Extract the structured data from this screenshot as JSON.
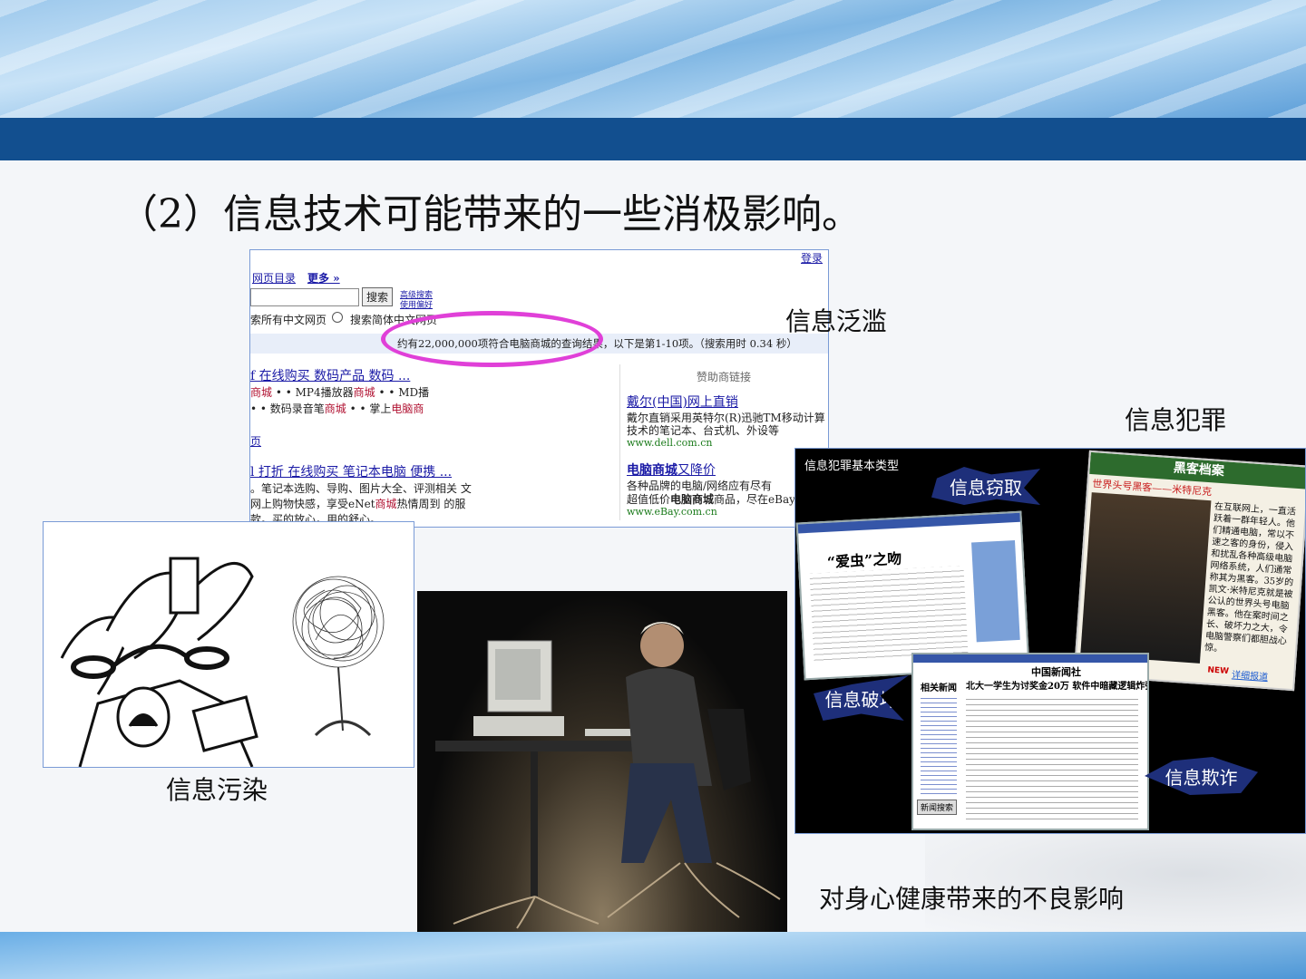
{
  "slide": {
    "heading": "（2）信息技术可能带来的一些消极影响。"
  },
  "captions": {
    "overload": "信息泛滥",
    "crime": "信息犯罪",
    "pollution": "信息污染",
    "health": "对身心健康带来的不良影响"
  },
  "search_screenshot": {
    "login": "登录",
    "nav_directory": "网页目录",
    "nav_more": "更多 »",
    "search_button": "搜索",
    "adv_search": "高级搜索",
    "preferences": "使用偏好",
    "scope_all": "索所有中文网页",
    "scope_simplified": "搜索简体中文网页",
    "result_summary": "约有22,000,000项符合电脑商城的查询结果，以下是第1-10项。（搜索用时 0.34 秒）",
    "result1_title": "f 在线购买 数码产品 数码 ...",
    "result1_line1_a": "商城",
    "result1_line1_b": " • • MP4播放器",
    "result1_line1_c": "商城",
    "result1_line1_d": " • • MD播",
    "result1_line2_a": "• • 数码录音笔",
    "result1_line2_b": "商城",
    "result1_line2_c": " • • 掌上",
    "result1_line2_d": "电脑商",
    "result_page_link": "页",
    "result2_title": "l 打折 在线购买 笔记本电脑 便携 ...",
    "result2_line1": "。笔记本选购、导购、图片大全、评测相关 文",
    "result2_line2_a": "网上购物快感，享受eNet",
    "result2_line2_b": "商城",
    "result2_line2_c": "热情周到 的服",
    "result2_line3": "款。买的放心，用的舒心。",
    "sponsor_header": "赞助商链接",
    "ad1_title": "戴尔(中国)网上直销",
    "ad1_line1": "戴尔直销采用英特尔(R)迅驰TM移动计算",
    "ad1_line2": "技术的笔记本、台式机、外设等",
    "ad1_url": "www.dell.com.cn",
    "ad2_title_a": "电脑商城",
    "ad2_title_b": "又降价",
    "ad2_line1": "各种品牌的电脑/网络应有尽有",
    "ad2_line2_a": "超值低价",
    "ad2_line2_b": "电脑商城",
    "ad2_line2_c": "商品，尽在eBay",
    "ad2_url": "www.eBay.com.cn"
  },
  "crime_panel": {
    "title": "信息犯罪基本类型",
    "theft": "信息窃取",
    "sabotage": "信息破坏",
    "fraud": "信息欺诈",
    "article1_headline": "“爱虫”之吻",
    "article2_headline": "北大一学生为讨奖金20万 软件中暗藏逻辑炸弹",
    "article2_paper": "中国新闻社",
    "article2_sidebar": "相关新闻",
    "article2_button": "新闻搜索",
    "hacker_banner": "黑客档案",
    "hacker_headline": "世界头号黑客——米特尼克",
    "hacker_text": "在互联网上，一直活跃着一群年轻人。他们精通电脑，常以不速之客的身份，侵入和扰乱各种高级电脑网络系统，人们通常称其为黑客。35岁的凯文·米特尼克就是被公认的世界头号电脑黑客。他在案时间之长、破坏力之大，令电脑警察们都胆战心惊。",
    "hacker_new": "NEW",
    "hacker_more": "详细报道"
  }
}
